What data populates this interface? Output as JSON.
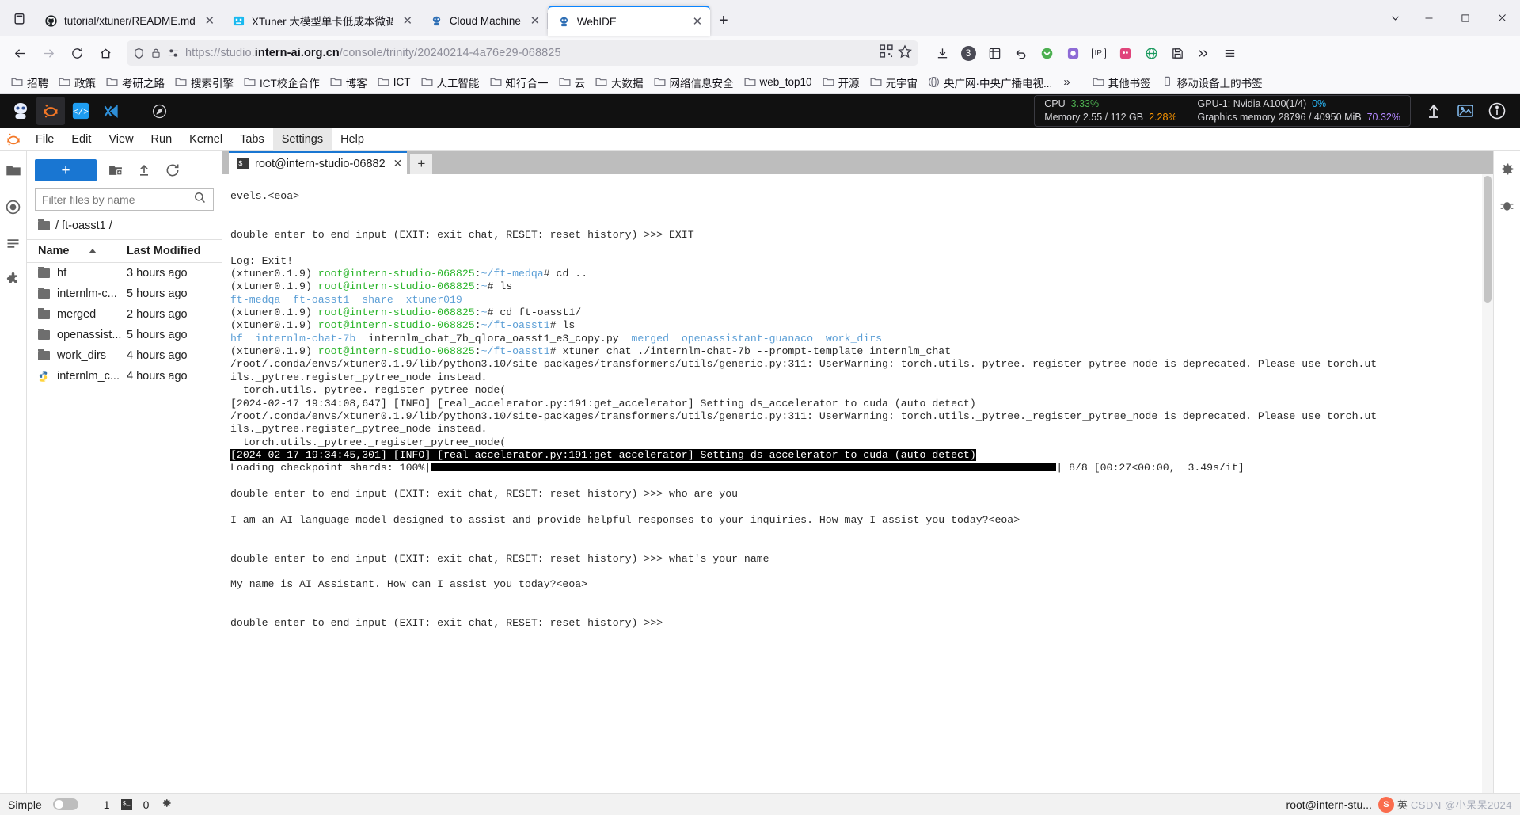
{
  "browser": {
    "tabs": [
      {
        "title": "tutorial/xtuner/README.md",
        "favicon": "github-icon",
        "active": false
      },
      {
        "title": "XTuner 大模型单卡低成本微调",
        "favicon": "xtuner-icon",
        "active": false
      },
      {
        "title": "Cloud Machine",
        "favicon": "intern-icon",
        "active": false
      },
      {
        "title": "WebIDE",
        "favicon": "intern-icon",
        "active": true
      }
    ],
    "new_tab_label": "+",
    "window_controls": {
      "list_all_tabs": "⌄",
      "minimize": "—",
      "maximize": "▢",
      "close": "✕"
    },
    "nav": {
      "back": "←",
      "forward": "→",
      "reload": "⟳",
      "home": "⌂"
    },
    "url": {
      "prefix": "https://studio.",
      "host_bold": "intern-ai.org.cn",
      "path": "/console/trinity/20240214-4a76e29-068825"
    },
    "toolbar_right": [
      "download-icon",
      "account-badge",
      "extension-icon",
      "undo-icon",
      "pocket-icon",
      "colorpick-icon",
      "ip-icon",
      "tampermonkey-icon",
      "globe-icon",
      "save-icon",
      "overflow-icon",
      "menu-icon"
    ],
    "account_badge": "3",
    "ip_label": "IP.",
    "bookmarks": [
      {
        "label": "招聘",
        "icon": "folder-icon"
      },
      {
        "label": "政策",
        "icon": "folder-icon"
      },
      {
        "label": "考研之路",
        "icon": "folder-icon"
      },
      {
        "label": "搜索引擎",
        "icon": "folder-icon"
      },
      {
        "label": "ICT校企合作",
        "icon": "folder-icon"
      },
      {
        "label": "博客",
        "icon": "folder-icon"
      },
      {
        "label": "ICT",
        "icon": "folder-icon"
      },
      {
        "label": "人工智能",
        "icon": "folder-icon"
      },
      {
        "label": "知行合一",
        "icon": "folder-icon"
      },
      {
        "label": "云",
        "icon": "folder-icon"
      },
      {
        "label": "大数据",
        "icon": "folder-icon"
      },
      {
        "label": "网络信息安全",
        "icon": "folder-icon"
      },
      {
        "label": "web_top10",
        "icon": "folder-icon"
      },
      {
        "label": "开源",
        "icon": "folder-icon"
      },
      {
        "label": "元宇宙",
        "icon": "folder-icon"
      },
      {
        "label": "央广网·中央广播电视...",
        "icon": "globe-icon"
      }
    ],
    "bookmarks_overflow": "»",
    "bookmarks_right": [
      {
        "label": "其他书签",
        "icon": "folder-icon"
      },
      {
        "label": "移动设备上的书签",
        "icon": "device-icon"
      }
    ]
  },
  "jupyter": {
    "topbar_icons": [
      "jupyterhub-icon",
      "jupyterlab-icon",
      "code-icon",
      "vscode-icon",
      "compass-icon"
    ],
    "resources": {
      "cpu_label": "CPU",
      "cpu_value": "3.33%",
      "cpu_color": "#4caf50",
      "gpu_label": "GPU-1: Nvidia A100(1/4)",
      "gpu_value": "0%",
      "gpu_color": "#29b6f6",
      "mem_label": "Memory 2.55 / 112 GB",
      "mem_value": "2.28%",
      "mem_color": "#ff9800",
      "gmem_label": "Graphics memory 28796 / 40950 MiB",
      "gmem_value": "70.32%",
      "gmem_color": "#b388ff"
    },
    "top_right_icons": [
      "upload-icon",
      "image-icon",
      "info-icon"
    ],
    "menus": [
      {
        "label": "File",
        "active": false
      },
      {
        "label": "Edit",
        "active": false
      },
      {
        "label": "View",
        "active": false
      },
      {
        "label": "Run",
        "active": false
      },
      {
        "label": "Kernel",
        "active": false
      },
      {
        "label": "Tabs",
        "active": false
      },
      {
        "label": "Settings",
        "active": true
      },
      {
        "label": "Help",
        "active": false
      }
    ],
    "left_rail": [
      "file-browser-icon",
      "running-icon",
      "commands-icon",
      "extensions-icon"
    ],
    "right_rail": [
      "settings-gear-icon",
      "debugger-icon"
    ],
    "filebrowser": {
      "new_launcher_label": "+",
      "toolbar_icons": [
        "new-folder-icon",
        "upload-icon",
        "refresh-icon"
      ],
      "filter_placeholder": "Filter files by name",
      "search_icon": "search-icon",
      "breadcrumb": "/ ft-oasst1 /",
      "columns": {
        "name": "Name",
        "modified": "Last Modified"
      },
      "sort_icon": "sort-ascending-icon",
      "rows": [
        {
          "name": "hf",
          "modified": "3 hours ago",
          "type": "folder"
        },
        {
          "name": "internlm-c...",
          "modified": "5 hours ago",
          "type": "folder"
        },
        {
          "name": "merged",
          "modified": "2 hours ago",
          "type": "folder"
        },
        {
          "name": "openassist...",
          "modified": "5 hours ago",
          "type": "folder"
        },
        {
          "name": "work_dirs",
          "modified": "4 hours ago",
          "type": "folder"
        },
        {
          "name": "internlm_c...",
          "modified": "4 hours ago",
          "type": "python"
        }
      ]
    },
    "terminal": {
      "tab_title": "root@intern-studio-06882",
      "tab_icon": "shell-icon",
      "tab_close": "✕",
      "add_tab": "+",
      "lines": [
        {
          "segs": [
            {
              "t": "evels.<eoa>"
            }
          ]
        },
        {
          "segs": [
            {
              "t": ""
            }
          ]
        },
        {
          "segs": [
            {
              "t": ""
            }
          ]
        },
        {
          "segs": [
            {
              "t": "double enter to end input (EXIT: exit chat, RESET: reset history) >>> EXIT"
            }
          ]
        },
        {
          "segs": [
            {
              "t": ""
            }
          ]
        },
        {
          "segs": [
            {
              "t": "Log: Exit!"
            }
          ]
        },
        {
          "segs": [
            {
              "t": "(xtuner0.1.9) "
            },
            {
              "t": "root@intern-studio-068825",
              "c": "gr"
            },
            {
              "t": ":"
            },
            {
              "t": "~/ft-medqa",
              "c": "bl"
            },
            {
              "t": "# cd .."
            }
          ]
        },
        {
          "segs": [
            {
              "t": "(xtuner0.1.9) "
            },
            {
              "t": "root@intern-studio-068825",
              "c": "gr"
            },
            {
              "t": ":"
            },
            {
              "t": "~",
              "c": "bl"
            },
            {
              "t": "# ls"
            }
          ]
        },
        {
          "segs": [
            {
              "t": "ft-medqa  ft-oasst1  share  xtuner019",
              "c": "bl"
            }
          ]
        },
        {
          "segs": [
            {
              "t": "(xtuner0.1.9) "
            },
            {
              "t": "root@intern-studio-068825",
              "c": "gr"
            },
            {
              "t": ":"
            },
            {
              "t": "~",
              "c": "bl"
            },
            {
              "t": "# cd ft-oasst1/"
            }
          ]
        },
        {
          "segs": [
            {
              "t": "(xtuner0.1.9) "
            },
            {
              "t": "root@intern-studio-068825",
              "c": "gr"
            },
            {
              "t": ":"
            },
            {
              "t": "~/ft-oasst1",
              "c": "bl"
            },
            {
              "t": "# ls"
            }
          ]
        },
        {
          "segs": [
            {
              "t": "hf",
              "c": "bl"
            },
            {
              "t": "  "
            },
            {
              "t": "internlm-chat-7b",
              "c": "bl"
            },
            {
              "t": "  internlm_chat_7b_qlora_oasst1_e3_copy.py  "
            },
            {
              "t": "merged",
              "c": "bl"
            },
            {
              "t": "  "
            },
            {
              "t": "openassistant-guanaco",
              "c": "bl"
            },
            {
              "t": "  "
            },
            {
              "t": "work_dirs",
              "c": "bl"
            }
          ]
        },
        {
          "segs": [
            {
              "t": "(xtuner0.1.9) "
            },
            {
              "t": "root@intern-studio-068825",
              "c": "gr"
            },
            {
              "t": ":"
            },
            {
              "t": "~/ft-oasst1",
              "c": "bl"
            },
            {
              "t": "# xtuner chat ./internlm-chat-7b --prompt-template internlm_chat"
            }
          ]
        },
        {
          "segs": [
            {
              "t": "/root/.conda/envs/xtuner0.1.9/lib/python3.10/site-packages/transformers/utils/generic.py:311: UserWarning: torch.utils._pytree._register_pytree_node is deprecated. Please use torch.ut"
            }
          ]
        },
        {
          "segs": [
            {
              "t": "ils._pytree.register_pytree_node instead."
            }
          ]
        },
        {
          "segs": [
            {
              "t": "  torch.utils._pytree._register_pytree_node("
            }
          ]
        },
        {
          "segs": [
            {
              "t": "[2024-02-17 19:34:08,647] [INFO] [real_accelerator.py:191:get_accelerator] Setting ds_accelerator to cuda (auto detect)"
            }
          ]
        },
        {
          "segs": [
            {
              "t": "/root/.conda/envs/xtuner0.1.9/lib/python3.10/site-packages/transformers/utils/generic.py:311: UserWarning: torch.utils._pytree._register_pytree_node is deprecated. Please use torch.ut"
            }
          ]
        },
        {
          "segs": [
            {
              "t": "ils._pytree.register_pytree_node instead."
            }
          ]
        },
        {
          "segs": [
            {
              "t": "  torch.utils._pytree._register_pytree_node("
            }
          ]
        },
        {
          "segs": [
            {
              "t": "[2024-02-17 19:34:45,301] [INFO] [real_accelerator.py:191:get_accelerator] Setting ds_accelerator to cuda (auto detect)",
              "hl": true
            }
          ]
        },
        {
          "segs": [
            {
              "t": "Loading checkpoint shards: 100%|",
              "bar": true
            },
            {
              "t": "| 8/8 [00:27<00:00,  3.49s/it]"
            }
          ]
        },
        {
          "segs": [
            {
              "t": ""
            }
          ]
        },
        {
          "segs": [
            {
              "t": "double enter to end input (EXIT: exit chat, RESET: reset history) >>> who are you"
            }
          ]
        },
        {
          "segs": [
            {
              "t": ""
            }
          ]
        },
        {
          "segs": [
            {
              "t": "I am an AI language model designed to assist and provide helpful responses to your inquiries. How may I assist you today?<eoa>"
            }
          ]
        },
        {
          "segs": [
            {
              "t": ""
            }
          ]
        },
        {
          "segs": [
            {
              "t": ""
            }
          ]
        },
        {
          "segs": [
            {
              "t": "double enter to end input (EXIT: exit chat, RESET: reset history) >>> what's your name"
            }
          ]
        },
        {
          "segs": [
            {
              "t": ""
            }
          ]
        },
        {
          "segs": [
            {
              "t": "My name is AI Assistant. How can I assist you today?<eoa>"
            }
          ]
        },
        {
          "segs": [
            {
              "t": ""
            }
          ]
        },
        {
          "segs": [
            {
              "t": ""
            }
          ]
        },
        {
          "segs": [
            {
              "t": "double enter to end input (EXIT: exit chat, RESET: reset history) >>> ",
              "cursor": true
            }
          ]
        }
      ]
    },
    "statusbar": {
      "mode_label": "Simple",
      "count_left": "1",
      "shell_icon": "shell-icon",
      "count_right": "0",
      "settings_icon": "gear-icon",
      "right_text": "root@intern-stu...",
      "ime_label": "英",
      "watermark_badge": "S",
      "watermark_text": "CSDN @小呆呆2024"
    }
  }
}
